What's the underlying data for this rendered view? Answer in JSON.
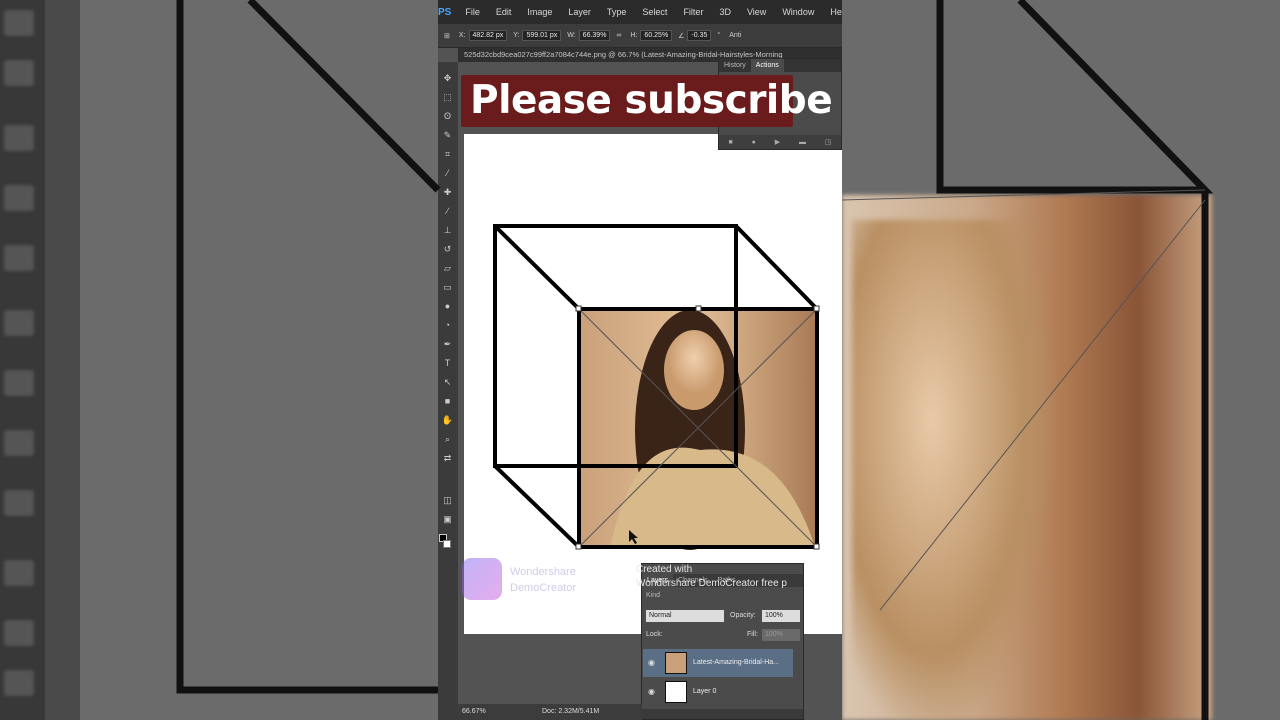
{
  "menu": {
    "logo": "PS",
    "items": [
      "File",
      "Edit",
      "Image",
      "Layer",
      "Type",
      "Select",
      "Filter",
      "3D",
      "View",
      "Window",
      "Help"
    ]
  },
  "options": {
    "x_label": "X:",
    "x_value": "482.82 px",
    "y_label": "Y:",
    "y_value": "599.01 px",
    "w_label": "W:",
    "w_value": "66.39%",
    "h_label": "H:",
    "h_value": "60.25%",
    "angle_value": "-0.35",
    "angle_unit": "°",
    "antialias": "Anti"
  },
  "document_tab": "525d32cbd9cea027c99ff2a7084c744e.png @ 66.7% (Latest-Amazing-Bridal-Hairstyles-Morning",
  "banner": "Please subscribe",
  "history_panel": {
    "tabs": [
      "History",
      "Actions"
    ],
    "active": "Actions"
  },
  "watermark": {
    "line1": "Wondershare",
    "line2": "DemoCreator",
    "overlay": "Created with\nWondershare DemoCreator free p"
  },
  "layers_panel": {
    "tabs": [
      "Layers",
      "Channels",
      "Paths"
    ],
    "kind": "Kind",
    "blend_mode": "Normal",
    "opacity_label": "Opacity:",
    "opacity_value": "100%",
    "lock_label": "Lock:",
    "fill_label": "Fill:",
    "fill_value": "100%",
    "layers": [
      {
        "name": "Latest-Amazing-Bridal-Ha...",
        "selected": true
      },
      {
        "name": "Layer 0",
        "selected": false
      }
    ]
  },
  "status": {
    "zoom": "66.67%",
    "doc": "Doc: 2.32M/5.41M"
  },
  "colors": {
    "banner": "#6a1c1c",
    "ui_dark": "#2b2b2b",
    "panel": "#4b4b4b",
    "selection": "#5a6f86"
  }
}
